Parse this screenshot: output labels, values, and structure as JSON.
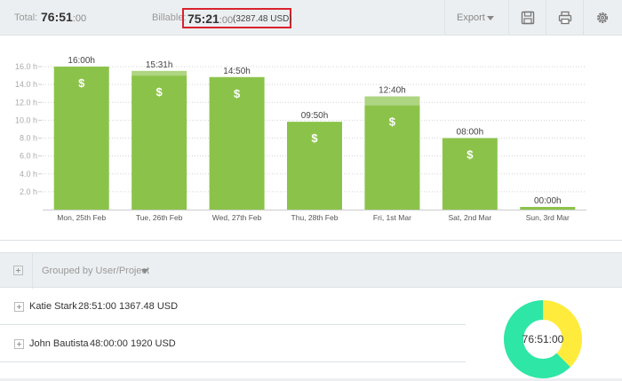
{
  "summary": {
    "total_label": "Total:",
    "total_hm": "76:51",
    "total_sec": ":00",
    "billable_label": "Billable:",
    "billable_hm": "75:21",
    "billable_sec": ":00",
    "billable_amount": "(3287.48 USD)"
  },
  "toolbar": {
    "export_label": "Export",
    "save_icon": "save-icon",
    "print_icon": "print-icon",
    "settings_icon": "gear-icon"
  },
  "chart_data": {
    "type": "bar",
    "categories": [
      "Mon, 25th Feb",
      "Tue, 26th Feb",
      "Wed, 27th Feb",
      "Thu, 28th Feb",
      "Fri, 1st Mar",
      "Sat, 2nd Mar",
      "Sun, 3rd Mar"
    ],
    "series": [
      {
        "values": [
          16.0,
          15.0,
          14.83,
          9.83,
          11.67,
          8.0,
          0
        ]
      },
      {
        "values": [
          0,
          0.52,
          0,
          0,
          1.0,
          0,
          0
        ]
      }
    ],
    "bar_labels": [
      "16:00h",
      "15:31h",
      "14:50h",
      "09:50h",
      "12:40h",
      "08:00h",
      "00:00h"
    ],
    "billable_marker": "$",
    "y_ticks": [
      2,
      4,
      6,
      8,
      10,
      12,
      14,
      16
    ],
    "y_tick_labels": [
      "2.0 h",
      "4.0 h",
      "6.0 h",
      "8.0 h",
      "10.0 h",
      "12.0 h",
      "14.0 h",
      "16.0 h"
    ],
    "ylim": [
      0,
      16.2
    ],
    "grid": true,
    "colors": {
      "billable": "#8bc34a",
      "non_billable": "#aed581"
    }
  },
  "grouping": {
    "label": "Grouped by User/Project"
  },
  "rows": [
    {
      "name": "Katie Stark",
      "duration": "28:51:00",
      "amount": "1367.48 USD"
    },
    {
      "name": "John Bautista",
      "duration": "48:00:00",
      "amount": "1920 USD"
    }
  ],
  "donut": {
    "center_label": "76:51:00",
    "values": [
      28.85,
      48.0
    ],
    "colors": [
      "#ffeb3b",
      "#2ee6a6"
    ]
  }
}
